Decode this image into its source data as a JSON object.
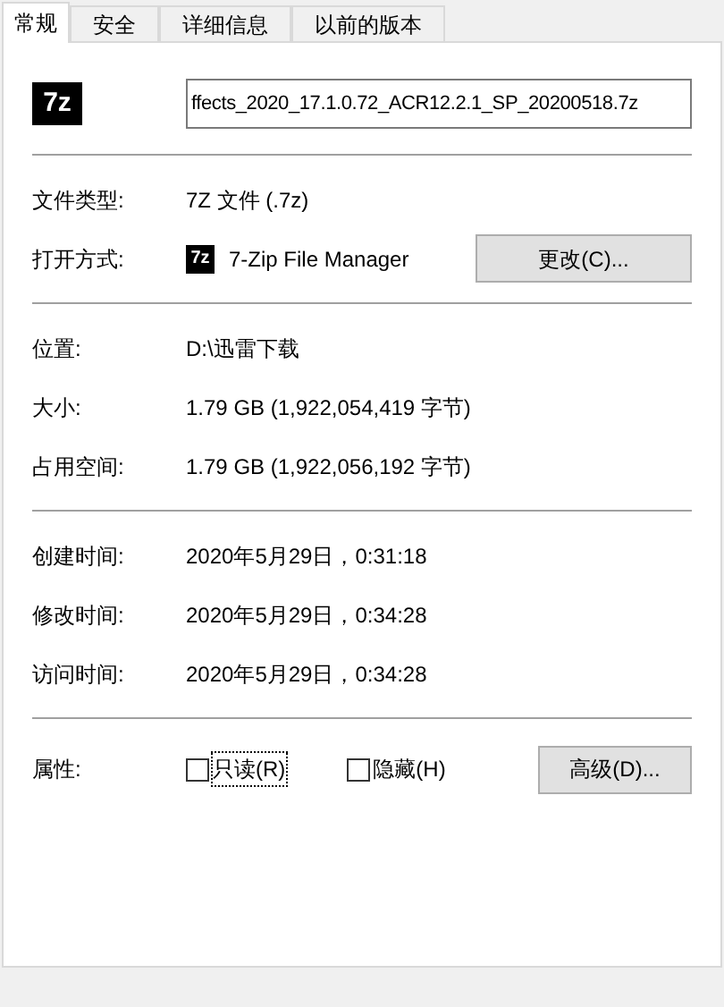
{
  "tabs": [
    {
      "label": "常规",
      "selected": true
    },
    {
      "label": "安全",
      "selected": false
    },
    {
      "label": "详细信息",
      "selected": false
    },
    {
      "label": "以前的版本",
      "selected": false
    }
  ],
  "file_name": {
    "value": "ffects_2020_17.1.0.72_ACR12.2.1_SP_20200518.7z"
  },
  "type_section": [
    {
      "label": "文件类型:",
      "value": "7Z 文件 (.7z)"
    },
    {
      "label": "打开方式:",
      "value": "7-Zip File Manager",
      "app_icon_text": "7z",
      "button": "更改(C)..."
    }
  ],
  "location_section": [
    {
      "label": "位置:",
      "value": "D:\\迅雷下载"
    },
    {
      "label": "大小:",
      "value": "1.79 GB (1,922,054,419 字节)"
    },
    {
      "label": "占用空间:",
      "value": "1.79 GB (1,922,056,192 字节)"
    }
  ],
  "time_section": [
    {
      "label": "创建时间:",
      "value": "2020年5月29日，0:31:18"
    },
    {
      "label": "修改时间:",
      "value": "2020年5月29日，0:34:28"
    },
    {
      "label": "访问时间:",
      "value": "2020年5月29日，0:34:28"
    }
  ],
  "file_icon_text": "7z",
  "attributes": {
    "label": "属性:",
    "checkboxes": [
      {
        "label": "只读(R)",
        "checked": false,
        "focused": true
      },
      {
        "label": "隐藏(H)",
        "checked": false,
        "focused": false
      }
    ],
    "button": "高级(D)..."
  }
}
